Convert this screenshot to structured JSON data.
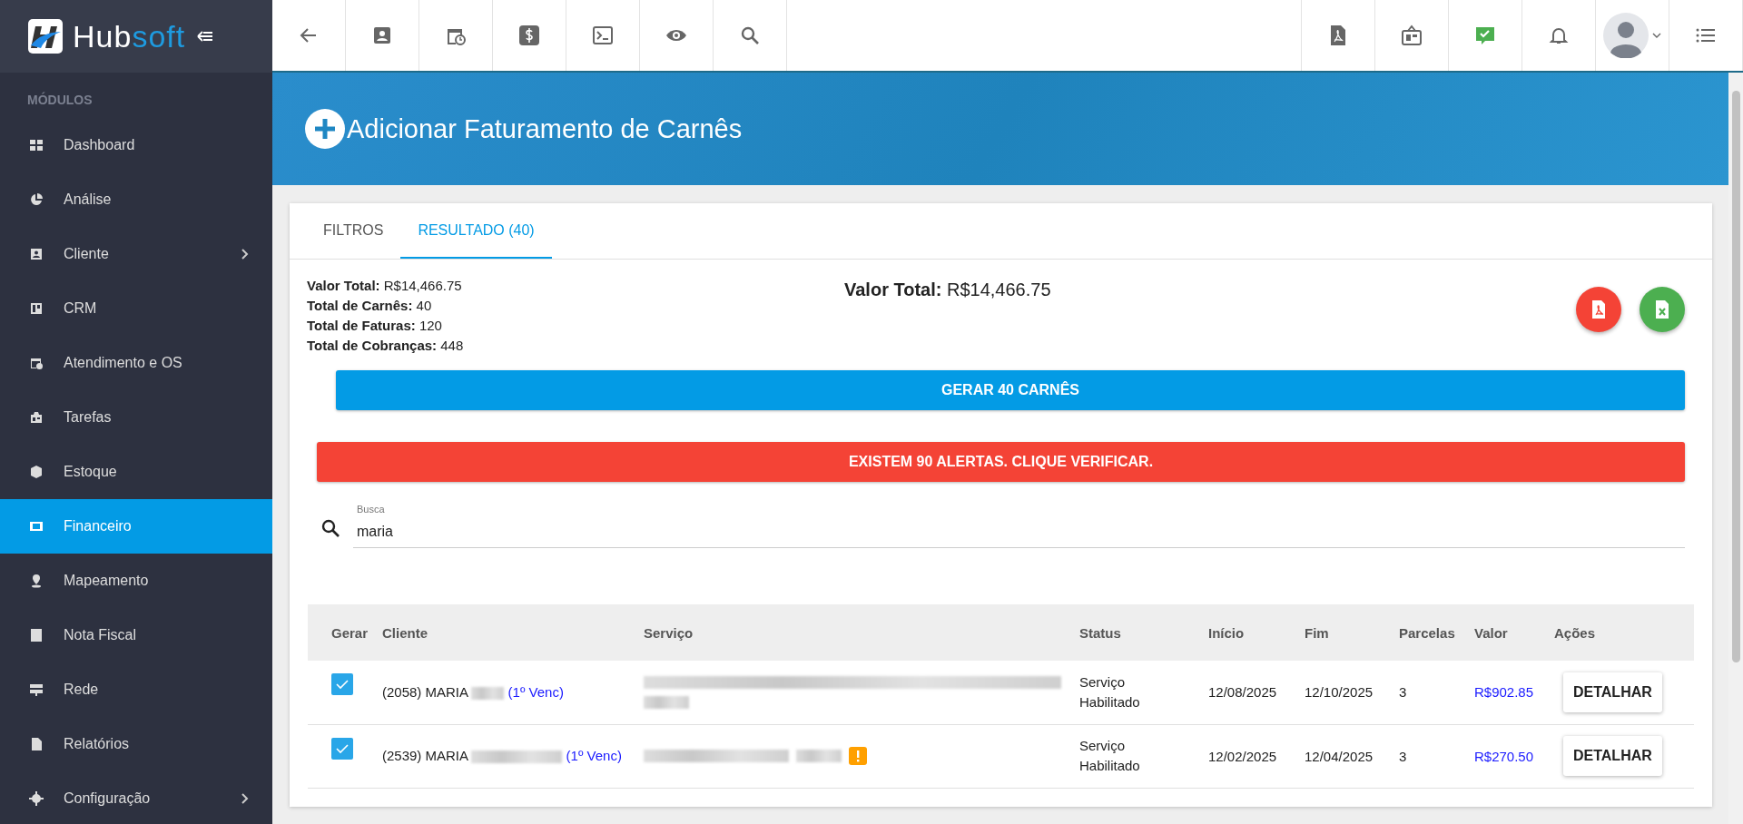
{
  "logo": {
    "part_1": "Hub",
    "part_2": "soft"
  },
  "sidebar": {
    "section": "MÓDULOS",
    "items": [
      {
        "label": "Dashboard",
        "selected": false,
        "has_children": false
      },
      {
        "label": "Análise",
        "selected": false,
        "has_children": false
      },
      {
        "label": "Cliente",
        "selected": false,
        "has_children": true
      },
      {
        "label": "CRM",
        "selected": false,
        "has_children": false
      },
      {
        "label": "Atendimento e OS",
        "selected": false,
        "has_children": false
      },
      {
        "label": "Tarefas",
        "selected": false,
        "has_children": false
      },
      {
        "label": "Estoque",
        "selected": false,
        "has_children": false
      },
      {
        "label": "Financeiro",
        "selected": true,
        "has_children": false
      },
      {
        "label": "Mapeamento",
        "selected": false,
        "has_children": false
      },
      {
        "label": "Nota Fiscal",
        "selected": false,
        "has_children": false
      },
      {
        "label": "Rede",
        "selected": false,
        "has_children": false
      },
      {
        "label": "Relatórios",
        "selected": false,
        "has_children": false
      },
      {
        "label": "Configuração",
        "selected": false,
        "has_children": true
      }
    ]
  },
  "page_title": "Adicionar Faturamento de Carnês",
  "tabs": [
    {
      "label": "FILTROS",
      "selected": false
    },
    {
      "label": "RESULTADO (40)",
      "selected": true
    }
  ],
  "summary": [
    {
      "label": "Valor Total:",
      "value": "R$14,466.75"
    },
    {
      "label": "Total de Carnês:",
      "value": "40"
    },
    {
      "label": "Total de Faturas:",
      "value": "120"
    },
    {
      "label": "Total de Cobranças:",
      "value": "448"
    }
  ],
  "total": {
    "label": "Valor Total:",
    "value": "R$14,466.75"
  },
  "generate_button": "GERAR 40 CARNÊS",
  "alert_button": "EXISTEM 90 ALERTAS. CLIQUE VERIFICAR.",
  "search": {
    "label": "Busca",
    "value": "maria"
  },
  "table": {
    "columns": [
      "Gerar",
      "Cliente",
      "Serviço",
      "Status",
      "Início",
      "Fim",
      "Parcelas",
      "Valor",
      "Ações"
    ],
    "rows": [
      {
        "checked": true,
        "client": "(2058) MARIA",
        "due": "(1º Venc)",
        "status": "Serviço Habilitado",
        "start": "12/08/2025",
        "end": "12/10/2025",
        "installments": "3",
        "value": "R$902.85",
        "action": "DETALHAR",
        "warning": false
      },
      {
        "checked": true,
        "client": "(2539) MARIA",
        "due": "(1º Venc)",
        "status": "Serviço Habilitado",
        "start": "12/02/2025",
        "end": "12/04/2025",
        "installments": "3",
        "value": "R$270.50",
        "action": "DETALHAR",
        "warning": true
      }
    ]
  }
}
